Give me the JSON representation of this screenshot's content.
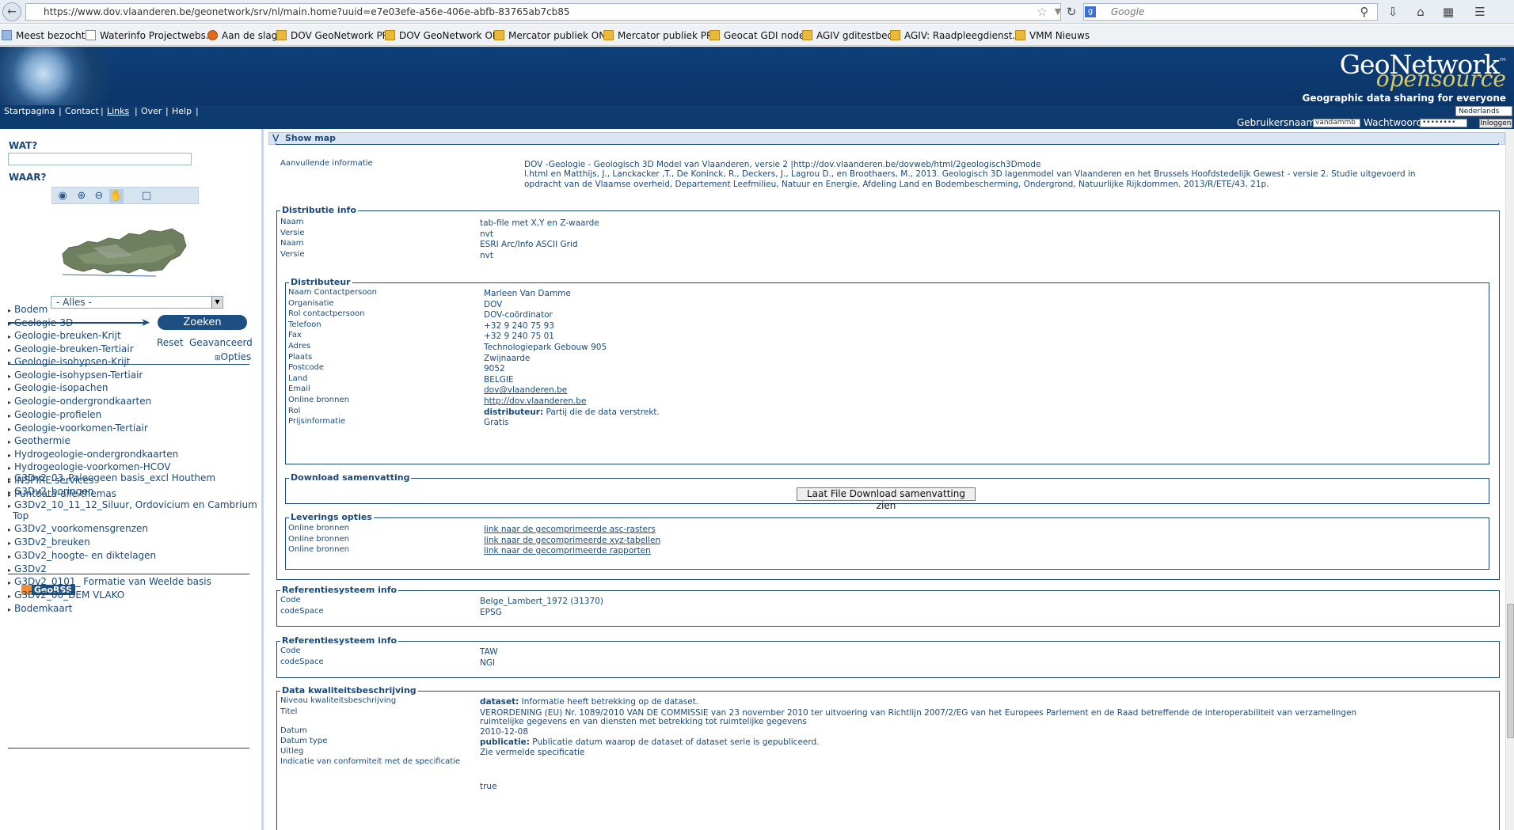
{
  "browser": {
    "url": "https://www.dov.vlaanderen.be/geonetwork/srv/nl/main.home?uuid=e7e03efe-a56e-406e-abfb-83765ab7cb85",
    "search_placeholder": "Google",
    "bookmarks": [
      "Meest bezocht",
      "Waterinfo Projectwebs...",
      "Aan de slag",
      "DOV GeoNetwork PR",
      "DOV GeoNetwork OE",
      "Mercator publiek ON",
      "Mercator publiek PR",
      "Geocat GDI node",
      "AGIV gditestbed",
      "AGIV: Raadpleegdienst...",
      "VMM Nieuws"
    ]
  },
  "banner": {
    "logo_top": "GeoNetwork",
    "logo_trademark": "™",
    "logo_bottom": "opensource",
    "tagline": "Geographic data sharing for everyone"
  },
  "topmenu": {
    "items": [
      "Startpagina",
      "Contact",
      "Links",
      "Over",
      "Help"
    ],
    "separator": "|",
    "language": "Nederlands"
  },
  "login": {
    "username_label": "Gebruikersnaam",
    "username_value": "vandammb",
    "password_label": "Wachtwoord",
    "password_value": "••••••••",
    "login_button": "Inloggen"
  },
  "sidebar": {
    "wat_label": "WAT?",
    "waar_label": "WAAR?",
    "region_select": "- Alles -",
    "search_button": "Zoeken",
    "reset": "Reset",
    "advanced": "Geavanceerd",
    "options": "Opties",
    "categories": [
      "Bodem",
      "Geologie-3D",
      "Geologie-breuken-Krijt",
      "Geologie-breuken-Tertiair",
      "Geologie-isohypsen-Krijt",
      "Geologie-isohypsen-Tertiair",
      "Geologie-isopachen",
      "Geologie-ondergrondkaarten",
      "Geologie-profielen",
      "Geologie-voorkomen-Tertiair",
      "Geothermie",
      "Hydrogeologie-ondergrondkaarten",
      "Hydrogeologie-voorkomen-HCOV",
      "INSPIRE-services",
      "Puntdata-alle-themas"
    ],
    "georss_label": "GeoRSS",
    "rss_items": [
      "G3Dv2_03_Paleogeen basis_excl Houthem",
      "G3Dv2_boringen",
      "G3Dv2_10_11_12_Siluur, Ordovicium en Cambrium",
      "Top",
      "G3Dv2_voorkomensgrenzen",
      "G3Dv2_breuken",
      "G3Dv2_hoogte- en diktelagen",
      "G3Dv2",
      "G3Dv2_0101_ Formatie van Weelde basis",
      "G3Dv2_00_DEM VLAKO",
      "Bodemkaart"
    ]
  },
  "main": {
    "show_map": "Show map",
    "aanvullende": {
      "label": "Aanvullende informatie",
      "lines": [
        "DOV -Geologie - Geologisch 3D Model van Vlaanderen, versie 2 |http://dov.vlaanderen.be/dovweb/html/2geologisch3Dmode",
        "l.html en Matthijs, J., Lanckacker ,T., De Koninck, R., Deckers, J., Lagrou D., en Broothaers, M., 2013. Geologisch 3D lagenmodel van Vlaanderen en het Brussels Hoofdstedelijk Gewest - versie 2. Studie uitgevoerd in",
        "opdracht van de Vlaamse overheid, Departement Leefmilieu, Natuur en Energie, Afdeling Land en Bodembescherming, Ondergrond, Natuurlijke Rijkdommen. 2013/R/ETE/43, 21p."
      ]
    },
    "distributie": {
      "legend": "Distributie info",
      "rows": [
        {
          "label": "Naam",
          "value": "tab-file met X,Y en Z-waarde"
        },
        {
          "label": "Versie",
          "value": "nvt"
        },
        {
          "label": "Naam",
          "value": "ESRI Arc/Info ASCII Grid"
        },
        {
          "label": "Versie",
          "value": "nvt"
        }
      ]
    },
    "distributeur": {
      "legend": "Distributeur",
      "rows": [
        {
          "label": "Naam Contactpersoon",
          "value": "Marleen Van Damme"
        },
        {
          "label": "Organisatie",
          "value": "DOV"
        },
        {
          "label": "Rol contactpersoon",
          "value": "DOV-coördinator"
        },
        {
          "label": "Telefoon",
          "value": "+32 9 240 75 93"
        },
        {
          "label": "Fax",
          "value": "+32 9 240 75 01"
        },
        {
          "label": "Adres",
          "value": "Technologiepark Gebouw 905"
        },
        {
          "label": "Plaats",
          "value": "Zwijnaarde"
        },
        {
          "label": "Postcode",
          "value": "9052"
        },
        {
          "label": "Land",
          "value": "BELGIE"
        },
        {
          "label": "Email",
          "value": "dov@vlaanderen.be"
        },
        {
          "label": "Online bronnen",
          "value": "http://dov.vlaanderen.be"
        },
        {
          "label": "Rol",
          "value_bold": "distributeur:",
          "value": " Partij die de data verstrekt."
        },
        {
          "label": "Prijsinformatie",
          "value": "Gratis"
        }
      ]
    },
    "download": {
      "legend": "Download samenvatting",
      "button": "Laat File Download samenvatting zien"
    },
    "levering": {
      "legend": "Leverings opties",
      "rows": [
        {
          "label": "Online bronnen",
          "value": "link naar de gecomprimeerde asc-rasters"
        },
        {
          "label": "Online bronnen",
          "value": "link naar de gecomprimeerde xyz-tabellen"
        },
        {
          "label": "Online bronnen",
          "value": "link naar de gecomprimeerde rapporten"
        }
      ]
    },
    "ref1": {
      "legend": "Referentiesysteem info",
      "rows": [
        {
          "label": "Code",
          "value": "Belge_Lambert_1972 (31370)"
        },
        {
          "label": "codeSpace",
          "value": "EPSG"
        }
      ]
    },
    "ref2": {
      "legend": "Referentiesysteem info",
      "rows": [
        {
          "label": "Code",
          "value": "TAW"
        },
        {
          "label": "codeSpace",
          "value": "NGI"
        }
      ]
    },
    "kwaliteit": {
      "legend": "Data kwaliteitsbeschrijving",
      "rows": [
        {
          "label": "Niveau kwaliteitsbeschrijving",
          "value_bold": "dataset:",
          "value": " Informatie heeft betrekking op de dataset."
        },
        {
          "label": "Titel",
          "value": "VERORDENING (EU) Nr. 1089/2010 VAN DE COMMISSIE van 23 november 2010 ter uitvoering van Richtlijn 2007/2/EG van het Europees Parlement en de Raad betreffende de interoperabiliteit van verzamelingen",
          "value2": "ruimtelijke gegevens en van diensten met betrekking tot ruimtelijke gegevens"
        },
        {
          "label": "Datum",
          "value": "2010-12-08"
        },
        {
          "label": "Datum type",
          "value_bold": "publicatie:",
          "value": " Publicatie datum waarop de dataset of dataset serie is gepubliceerd."
        },
        {
          "label": "Uitleg",
          "value": "Zie vermelde specificatie"
        },
        {
          "label": "Indicatie van conformiteit met de specificatie",
          "value": ""
        },
        {
          "label": "",
          "value": "true"
        }
      ]
    }
  }
}
